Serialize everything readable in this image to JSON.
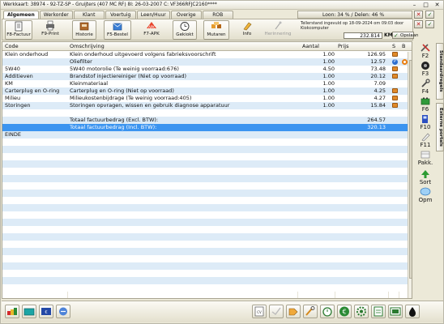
{
  "window": {
    "title": "Werkkaart: 38974 - 92-TZ-SP - Gruijters (407 MC RF) 8l: 26-03-2007 C: VF366RFJC2160****"
  },
  "tabs": [
    "Algemeen",
    "Werkorder",
    "Klant",
    "Voertuig",
    "Leen/Huur",
    "Overige",
    "ROB"
  ],
  "loon": "Loon: 34 % / Delen: 46 %",
  "toolbar": {
    "buttons": [
      {
        "label": "F8-Factuur",
        "icon": "invoice-icon"
      },
      {
        "label": "F9-Print",
        "icon": "printer-icon"
      },
      {
        "label": "Historie",
        "icon": "history-icon"
      },
      {
        "label": "F5-Bestel",
        "icon": "order-icon"
      },
      {
        "label": "F7-APK",
        "icon": "apk-icon"
      },
      {
        "label": "Gekiokt",
        "icon": "clock-icon"
      },
      {
        "label": "Mutaren",
        "icon": "mutations-icon"
      },
      {
        "label": "Info",
        "icon": "info-icon"
      },
      {
        "label": "Herinnering",
        "icon": "reminder-icon"
      }
    ],
    "teller": "Tellerstand ingevuld op 18-09-2024 om 09:03 door Kiokcomputer",
    "km_value": "232.814",
    "km_unit": "KM",
    "save_label": "Opslaan"
  },
  "table": {
    "headers": {
      "code": "Code",
      "omschrijving": "Omschrijving",
      "aantal": "Aantal",
      "prijs": "Prijs",
      "s": "S",
      "b": "B"
    },
    "rows": [
      {
        "code": "Klein onderhoud",
        "oms": "Klein onderhoud uitgevoerd volgens fabrieksvoorschrift",
        "aantal": "1.00",
        "prijs": "126.95",
        "s": "package",
        "b": ""
      },
      {
        "code": "",
        "oms": "Oliefilter",
        "aantal": "1.00",
        "prijs": "12.57",
        "s": "p",
        "b": "o"
      },
      {
        "code": "5W40",
        "oms": "5W40 motorolie (Te weinig voorraad:676)",
        "aantal": "4.50",
        "prijs": "73.48",
        "s": "package",
        "b": ""
      },
      {
        "code": "Additieven",
        "oms": "Brandstof injectiereiniger (Niet op voorraad)",
        "aantal": "1.00",
        "prijs": "20.12",
        "s": "package",
        "b": ""
      },
      {
        "code": "KM",
        "oms": "Kleinmateriaal",
        "aantal": "1.00",
        "prijs": "7.09",
        "s": "",
        "b": ""
      },
      {
        "code": "Carterplug en O-ring",
        "oms": "Carterplug en O-ring (Niet op voorraad)",
        "aantal": "1.00",
        "prijs": "4.25",
        "s": "package",
        "b": ""
      },
      {
        "code": "Milieu",
        "oms": "Milieukostenbijdrage (Te weinig voorraad:405)",
        "aantal": "1.00",
        "prijs": "4.27",
        "s": "package",
        "b": ""
      },
      {
        "code": "Storingen",
        "oms": "Storingen opvragen, wissen en gebruik diagnose apparatuur",
        "aantal": "1.00",
        "prijs": "15.84",
        "s": "package",
        "b": ""
      },
      {
        "code": "",
        "oms": "",
        "aantal": "",
        "prijs": "",
        "s": "",
        "b": ""
      },
      {
        "code": "",
        "oms": "Totaal factuurbedrag (Excl. BTW):",
        "aantal": "",
        "prijs": "264.57",
        "s": "",
        "b": ""
      },
      {
        "code": "",
        "oms": "Totaal factuurbedrag (Incl. BTW):",
        "aantal": "",
        "prijs": "320.13",
        "s": "",
        "b": "",
        "selected": true
      },
      {
        "code": "EINDE",
        "oms": "",
        "aantal": "",
        "prijs": "",
        "s": "",
        "b": ""
      }
    ]
  },
  "fkeys": [
    {
      "label": "F2",
      "icon": "tools-icon"
    },
    {
      "label": "F3",
      "icon": "tyre-icon"
    },
    {
      "label": "F4",
      "icon": "wrench-icon"
    },
    {
      "label": "F6",
      "icon": "battery-icon"
    },
    {
      "label": "F10",
      "icon": "fuel-icon"
    },
    {
      "label": "F11",
      "icon": "pencil-icon"
    },
    {
      "label": "Pakk.",
      "icon": "package-icon"
    },
    {
      "label": "Sort",
      "icon": "sort-icon"
    },
    {
      "label": "Opm",
      "icon": "comment-icon"
    }
  ],
  "sidetabs": [
    "Standaardregels",
    "Externe portals"
  ],
  "colors": {
    "selection": "#3b94f0",
    "stripe": "#ddebf7"
  }
}
